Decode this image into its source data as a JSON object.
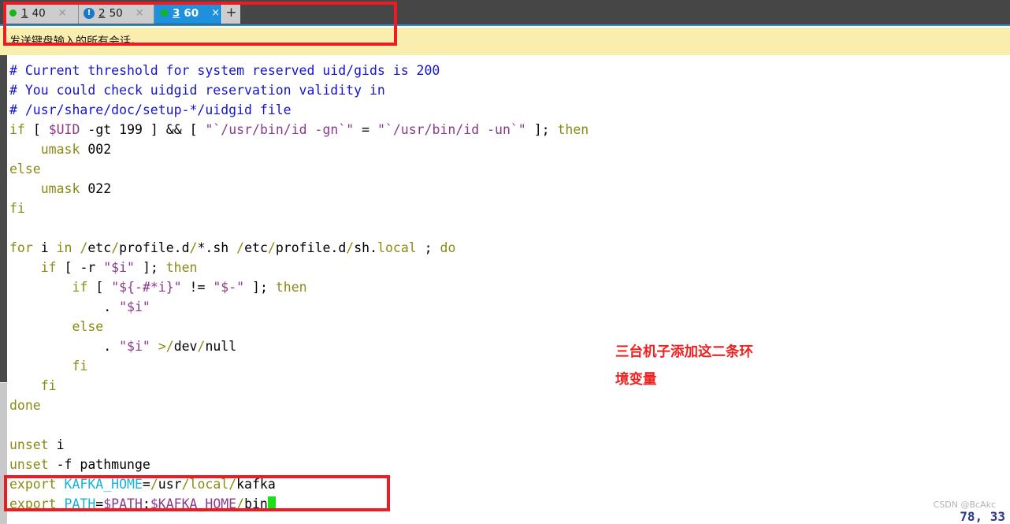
{
  "tabs": {
    "items": [
      {
        "name": "tab-1",
        "icon": "green-dot-icon",
        "num": "1",
        "label": "40",
        "active": false,
        "close": "×"
      },
      {
        "name": "tab-2",
        "icon": "blue-exclamation-icon",
        "num": "2",
        "label": "50",
        "active": false,
        "close": "×"
      },
      {
        "name": "tab-3",
        "icon": "green-dot-icon",
        "num": "3",
        "label": "60",
        "active": true,
        "close": "×"
      }
    ],
    "new_tab_label": "+",
    "active_bg": "#1e90dc",
    "inactive_bg": "#cdcdcd",
    "bar_bg": "#464646"
  },
  "notice": {
    "text": "发送键盘输入的所有会话。",
    "bg": "#f9eeae"
  },
  "terminal": {
    "lines": [
      "# Current threshold for system reserved uid/gids is 200",
      "# You could check uidgid reservation validity in",
      "# /usr/share/doc/setup-*/uidgid file",
      "if [ $UID -gt 199 ] && [ \"`/usr/bin/id -gn`\" = \"`/usr/bin/id -un`\" ]; then",
      "    umask 002",
      "else",
      "    umask 022",
      "fi",
      "",
      "for i in /etc/profile.d/*.sh /etc/profile.d/sh.local ; do",
      "    if [ -r \"$i\" ]; then",
      "        if [ \"${-#*i}\" != \"$-\" ]; then",
      "            . \"$i\"",
      "        else",
      "            . \"$i\" >/dev/null",
      "        fi",
      "    fi",
      "done",
      "",
      "unset i",
      "unset -f pathmunge",
      "export KAFKA_HOME=/usr/local/kafka",
      "export PATH=$PATH:$KAFKA_HOME/bin"
    ],
    "cursor_char": " ",
    "cursor_color": "#19e019"
  },
  "annotation": {
    "text": "三台机子添加这二条环\n境变量",
    "color": "#f02020"
  },
  "status": {
    "position": "78, 33"
  },
  "watermark": {
    "text": "CSDN @BcAkc"
  }
}
